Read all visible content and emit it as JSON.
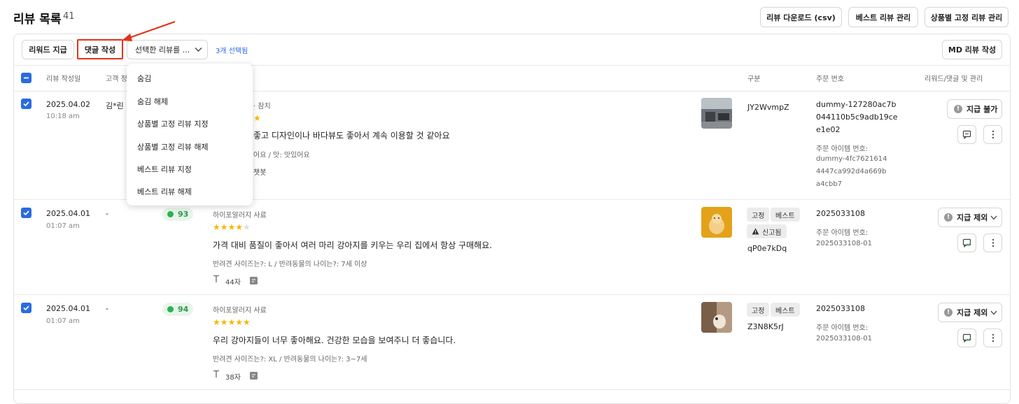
{
  "page": {
    "title": "리뷰 목록",
    "count": "41"
  },
  "top_actions": {
    "download": "리뷰 다운로드 (csv)",
    "best_manage": "베스트 리뷰 관리",
    "fixed_manage": "상품별 고정 리뷰 관리"
  },
  "toolbar": {
    "reward": "리워드 지급",
    "reply": "댓글 작성",
    "bulk_select": "선택한 리뷰를 ...",
    "selected_count": "3개 선택됨",
    "md_review": "MD 리뷰 작성"
  },
  "columns": {
    "date": "리뷰 작성일",
    "customer": "고객 정",
    "type": "구분",
    "order": "주문 번호",
    "manage": "리워드/댓글 및 관리"
  },
  "dropdown": {
    "items": [
      "숨김",
      "숨김 해제",
      "상품별 고정 리뷰 지정",
      "상품별 고정 리뷰 해제",
      "베스트 리뷰 지정",
      "베스트 리뷰 해제"
    ]
  },
  "colors": {
    "accent": "#2a6be0",
    "highlight": "#e0341a",
    "score_green": "#2fb052",
    "star": "#f5b800"
  },
  "rows": [
    {
      "date": "2025.04.02",
      "time": "10:18 am",
      "customer": "김*린",
      "product": "· 참치",
      "rating": 5,
      "text": "좋고 디자인이나 바다뷰도 좋아서 계속 이용할 것 같아요",
      "options": "어요 / 맛: 맛있어요",
      "meta": "챗봇",
      "type_code": "JY2WvmpZ",
      "order_no": "dummy-127280ac7b044110b5c9adb19cee1e02",
      "order_no_lines": [
        "dummy-127280ac7b",
        "044110b5c9adb19ce",
        "e1e02"
      ],
      "item_label": "주문 아이템 번호:",
      "item_no_lines": [
        "dummy-4fc7621614",
        "4447ca992d4a669b",
        "a4cbb7"
      ],
      "reward": "지급 불가",
      "icons": [
        "exclamation-icon",
        "comment-icon",
        "more-icon"
      ]
    },
    {
      "date": "2025.04.01",
      "time": "01:07 am",
      "customer": "-",
      "score": "93",
      "product": "하이포알러지 사료",
      "rating": 4,
      "text": "가격 대비 품질이 좋아서 여러 마리 강아지를 키우는 우리 집에서 항상 구매해요.",
      "options": "반려견 사이즈는?: L / 반려동물의 나이는?: 7세 이상",
      "meta": "44자",
      "tags": [
        "고정",
        "베스트"
      ],
      "report_tag": "신고됨",
      "type_code": "qP0e7kDq",
      "order_no": "2025033108",
      "item_label": "주문 아이템 번호:",
      "item_no": "2025033108-01",
      "reward": "지급 제외",
      "icons": [
        "exclamation-icon",
        "chevron-down-icon",
        "reply-comment-icon",
        "more-icon"
      ]
    },
    {
      "date": "2025.04.01",
      "time": "01:07 am",
      "customer": "-",
      "score": "94",
      "product": "하이포알러지 사료",
      "rating": 5,
      "text": "우리 강아지들이 너무 좋아해요. 건강한 모습을 보여주니 더 좋습니다.",
      "options": "반려견 사이즈는?: XL / 반려동물의 나이는?: 3~7세",
      "meta": "38자",
      "tags": [
        "고정",
        "베스트"
      ],
      "type_code": "Z3N8K5rJ",
      "order_no": "2025033108",
      "item_label": "주문 아이템 번호:",
      "item_no": "2025033108-01",
      "reward": "지급 제외",
      "icons": [
        "exclamation-icon",
        "chevron-down-icon",
        "reply-comment-icon",
        "more-icon"
      ]
    }
  ]
}
